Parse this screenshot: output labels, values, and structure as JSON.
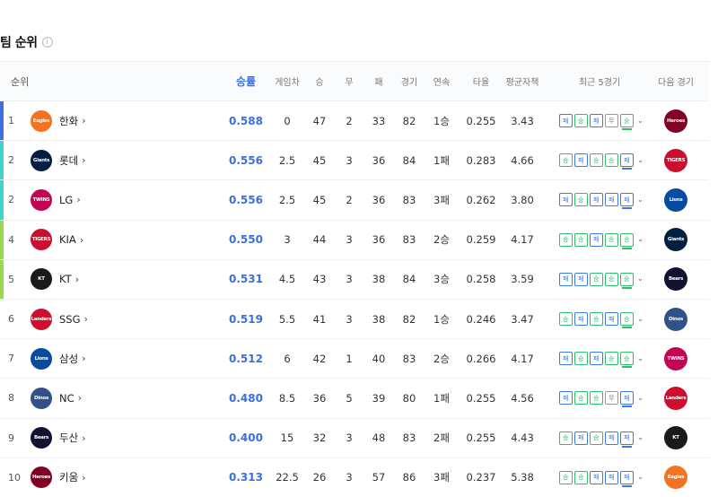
{
  "page": {
    "title": "팀 순위",
    "info_icon": "info-icon"
  },
  "headers": {
    "rank": "순위",
    "pct": "승률",
    "gb": "게임차",
    "w": "승",
    "d": "무",
    "l": "패",
    "g": "경기",
    "streak": "연속",
    "avg": "타율",
    "era": "평균자책",
    "recent": "최근 5경기",
    "next": "다음 경기"
  },
  "labels": {
    "win": "승",
    "loss": "패",
    "draw": "무"
  },
  "teams": [
    {
      "rank": "1",
      "name": "한화",
      "pct": "0.588",
      "gb": "0",
      "w": "47",
      "d": "2",
      "l": "33",
      "g": "82",
      "streak": "1승",
      "avg": "0.255",
      "era": "3.43",
      "recent": [
        "패",
        "승",
        "패",
        "무",
        "승"
      ],
      "logo_text": "Eagles",
      "logo_color": "#f37321",
      "next_text": "Heroes",
      "next_color": "#820024",
      "bar_color": "#3f6fe0"
    },
    {
      "rank": "2",
      "name": "롯데",
      "pct": "0.556",
      "gb": "2.5",
      "w": "45",
      "d": "3",
      "l": "36",
      "g": "84",
      "streak": "1패",
      "avg": "0.283",
      "era": "4.66",
      "recent": [
        "승",
        "패",
        "승",
        "승",
        "패"
      ],
      "logo_text": "Giants",
      "logo_color": "#041e42",
      "next_text": "TIGERS",
      "next_color": "#c8102e",
      "bar_color": "#3ed6cc"
    },
    {
      "rank": "2",
      "name": "LG",
      "pct": "0.556",
      "gb": "2.5",
      "w": "45",
      "d": "2",
      "l": "36",
      "g": "83",
      "streak": "3패",
      "avg": "0.262",
      "era": "3.80",
      "recent": [
        "패",
        "승",
        "패",
        "패",
        "패"
      ],
      "logo_text": "TWINS",
      "logo_color": "#c30452",
      "next_text": "Lions",
      "next_color": "#074ca1",
      "bar_color": "#3ed6cc"
    },
    {
      "rank": "4",
      "name": "KIA",
      "pct": "0.550",
      "gb": "3",
      "w": "44",
      "d": "3",
      "l": "36",
      "g": "83",
      "streak": "2승",
      "avg": "0.259",
      "era": "4.17",
      "recent": [
        "승",
        "승",
        "패",
        "승",
        "승"
      ],
      "logo_text": "TIGERS",
      "logo_color": "#c8102e",
      "next_text": "Giants",
      "next_color": "#041e42",
      "bar_color": "#9ad94f"
    },
    {
      "rank": "5",
      "name": "KT",
      "pct": "0.531",
      "gb": "4.5",
      "w": "43",
      "d": "3",
      "l": "38",
      "g": "84",
      "streak": "3승",
      "avg": "0.258",
      "era": "3.59",
      "recent": [
        "패",
        "패",
        "승",
        "승",
        "승"
      ],
      "logo_text": "KT",
      "logo_color": "#1a1a1a",
      "next_text": "Bears",
      "next_color": "#131230",
      "bar_color": "#9ad94f"
    },
    {
      "rank": "6",
      "name": "SSG",
      "pct": "0.519",
      "gb": "5.5",
      "w": "41",
      "d": "3",
      "l": "38",
      "g": "82",
      "streak": "1승",
      "avg": "0.246",
      "era": "3.47",
      "recent": [
        "승",
        "패",
        "승",
        "패",
        "승"
      ],
      "logo_text": "Landers",
      "logo_color": "#ce0e2d",
      "next_text": "Dinos",
      "next_color": "#315288",
      "bar_color": ""
    },
    {
      "rank": "7",
      "name": "삼성",
      "pct": "0.512",
      "gb": "6",
      "w": "42",
      "d": "1",
      "l": "40",
      "g": "83",
      "streak": "2승",
      "avg": "0.266",
      "era": "4.17",
      "recent": [
        "패",
        "승",
        "패",
        "승",
        "승"
      ],
      "logo_text": "Lions",
      "logo_color": "#074ca1",
      "next_text": "TWINS",
      "next_color": "#c30452",
      "bar_color": ""
    },
    {
      "rank": "8",
      "name": "NC",
      "pct": "0.480",
      "gb": "8.5",
      "w": "36",
      "d": "5",
      "l": "39",
      "g": "80",
      "streak": "1패",
      "avg": "0.255",
      "era": "4.56",
      "recent": [
        "패",
        "승",
        "승",
        "무",
        "패"
      ],
      "logo_text": "Dinos",
      "logo_color": "#315288",
      "next_text": "Landers",
      "next_color": "#ce0e2d",
      "bar_color": ""
    },
    {
      "rank": "9",
      "name": "두산",
      "pct": "0.400",
      "gb": "15",
      "w": "32",
      "d": "3",
      "l": "48",
      "g": "83",
      "streak": "2패",
      "avg": "0.255",
      "era": "4.43",
      "recent": [
        "승",
        "패",
        "승",
        "패",
        "패"
      ],
      "logo_text": "Bears",
      "logo_color": "#131230",
      "next_text": "KT",
      "next_color": "#1a1a1a",
      "bar_color": ""
    },
    {
      "rank": "10",
      "name": "키움",
      "pct": "0.313",
      "gb": "22.5",
      "w": "26",
      "d": "3",
      "l": "57",
      "g": "86",
      "streak": "3패",
      "avg": "0.237",
      "era": "5.38",
      "recent": [
        "승",
        "승",
        "패",
        "패",
        "패"
      ],
      "logo_text": "Heroes",
      "logo_color": "#820024",
      "next_text": "Eagles",
      "next_color": "#f37321",
      "bar_color": ""
    }
  ]
}
